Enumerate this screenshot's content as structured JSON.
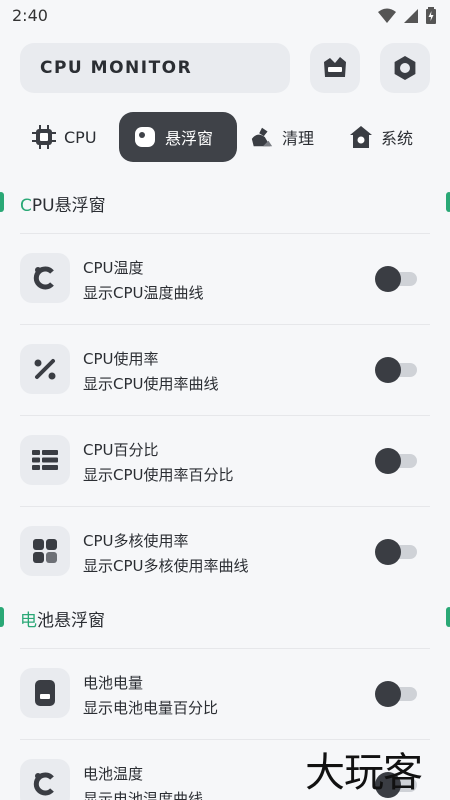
{
  "status": {
    "time": "2:40"
  },
  "app": {
    "title": "CPU MONITOR"
  },
  "tabs": [
    {
      "label": "CPU",
      "icon": "chip-icon",
      "active": false
    },
    {
      "label": "悬浮窗",
      "icon": "floating-window-icon",
      "active": true
    },
    {
      "label": "清理",
      "icon": "broom-icon",
      "active": false
    },
    {
      "label": "系统",
      "icon": "home-icon",
      "active": false
    }
  ],
  "sections": {
    "cpu": {
      "accent": "C",
      "rest": "PU悬浮窗"
    },
    "battery": {
      "accent": "电",
      "rest": "池悬浮窗"
    }
  },
  "rows": [
    {
      "title": "CPU温度",
      "desc": "显示CPU温度曲线",
      "icon": "temperature-icon",
      "enabled": false
    },
    {
      "title": "CPU使用率",
      "desc": "显示CPU使用率曲线",
      "icon": "percent-icon",
      "enabled": false
    },
    {
      "title": "CPU百分比",
      "desc": "显示CPU使用率百分比",
      "icon": "grid-list-icon",
      "enabled": false
    },
    {
      "title": "CPU多核使用率",
      "desc": "显示CPU多核使用率曲线",
      "icon": "multicore-icon",
      "enabled": false
    },
    {
      "title": "电池电量",
      "desc": "显示电池电量百分比",
      "icon": "battery-icon",
      "enabled": false
    },
    {
      "title": "电池温度",
      "desc": "显示电池温度曲线",
      "icon": "temperature-icon",
      "enabled": false
    }
  ],
  "watermark": "大玩客",
  "colors": {
    "accent": "#2aa876",
    "dark": "#3f4248",
    "surface": "#e9ebef"
  }
}
